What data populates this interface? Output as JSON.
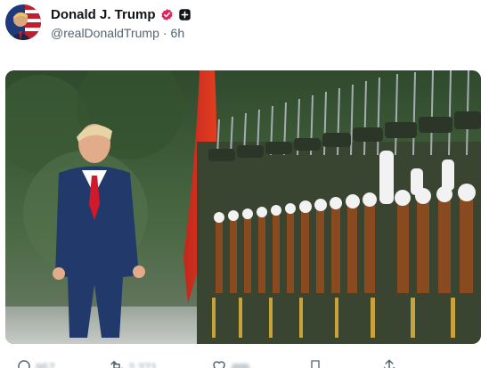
{
  "post": {
    "display_name": "Donald J. Trump",
    "handle": "@realDonaldTrump",
    "separator": "·",
    "time": "6h",
    "badges": [
      {
        "name": "verified-badge-icon",
        "color": "#e0245e"
      },
      {
        "name": "add-icon",
        "color": "#0f1419"
      }
    ],
    "image": {
      "description_icon": "photo-military-review"
    }
  },
  "actions": {
    "reply_count": "957",
    "repost_count": "2,271",
    "like_count": "",
    "icons": [
      "reply-icon",
      "repost-icon",
      "like-icon",
      "bookmark-icon",
      "share-icon"
    ]
  },
  "colors": {
    "text_primary": "#0f1419",
    "text_secondary": "#536471",
    "accent_badge": "#e0245e"
  }
}
